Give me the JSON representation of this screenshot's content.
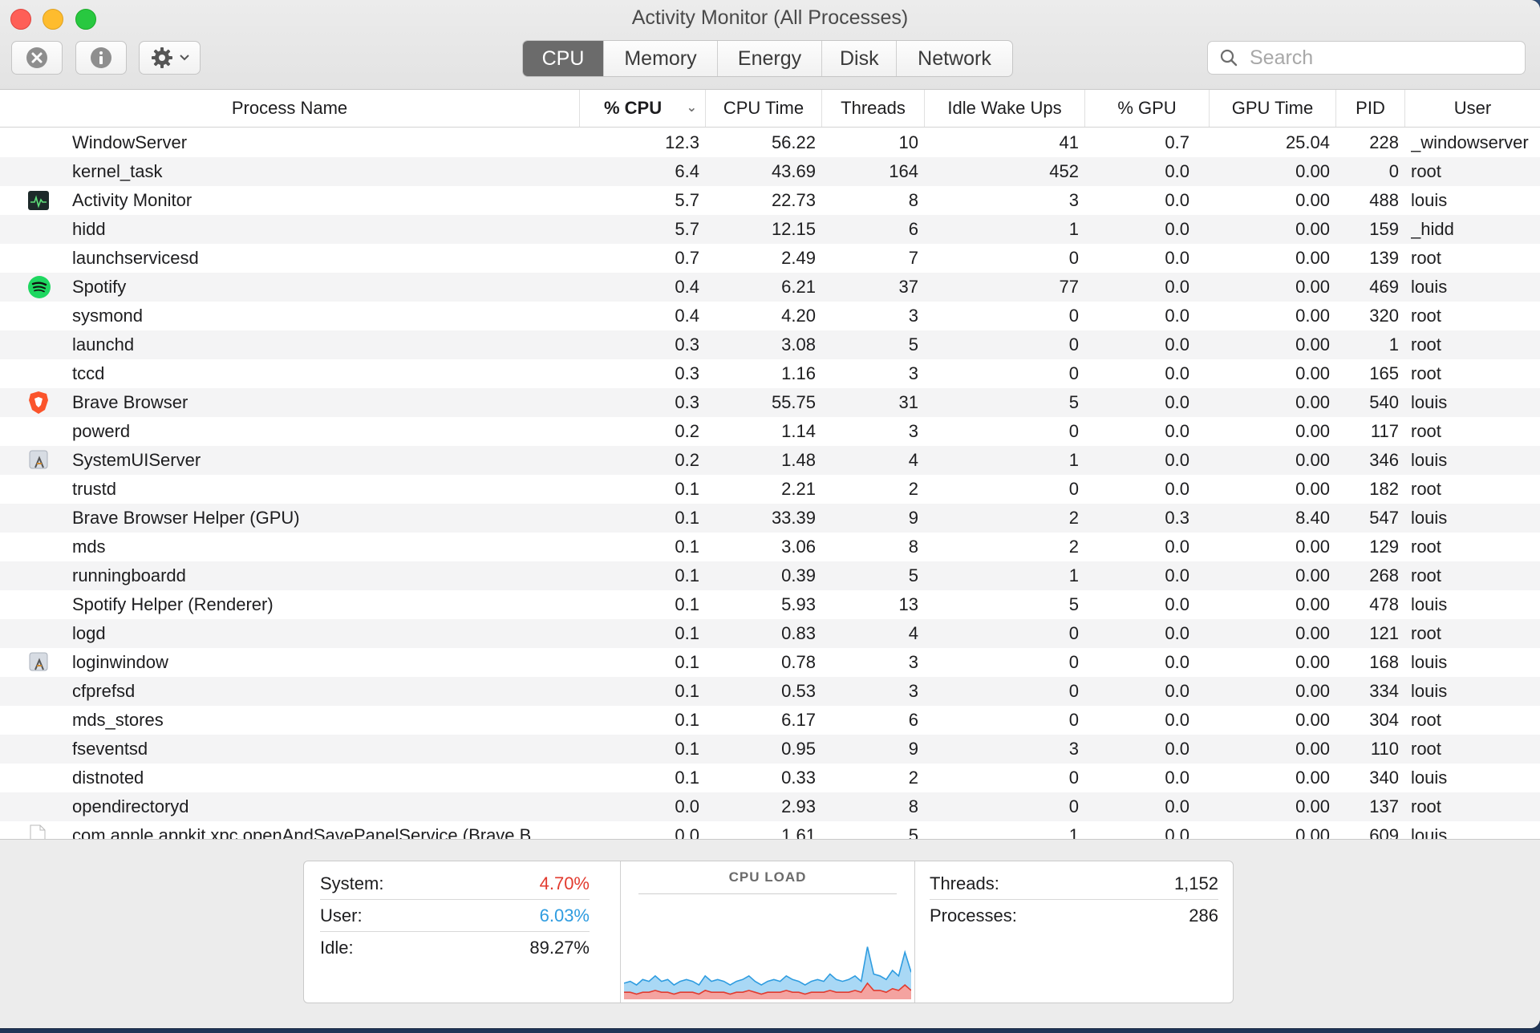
{
  "window": {
    "title": "Activity Monitor (All Processes)"
  },
  "toolbar": {
    "tabs": [
      {
        "label": "CPU",
        "active": true
      },
      {
        "label": "Memory",
        "active": false
      },
      {
        "label": "Energy",
        "active": false
      },
      {
        "label": "Disk",
        "active": false
      },
      {
        "label": "Network",
        "active": false
      }
    ],
    "search_placeholder": "Search",
    "icons": {
      "stop": "stop-process-icon",
      "info": "info-icon",
      "gear": "gear-icon"
    }
  },
  "table": {
    "columns": {
      "name": "Process Name",
      "cpu": "% CPU",
      "cpu_time": "CPU Time",
      "threads": "Threads",
      "idle_wake_ups": "Idle Wake Ups",
      "gpu": "% GPU",
      "gpu_time": "GPU Time",
      "pid": "PID",
      "user": "User"
    },
    "sorted_column": "cpu",
    "rows": [
      {
        "name": "WindowServer",
        "cpu": "12.3",
        "cpu_time": "56.22",
        "threads": "10",
        "idle": "41",
        "gpu": "0.7",
        "gpu_time": "25.04",
        "pid": "228",
        "user": "_windowserver",
        "icon": ""
      },
      {
        "name": "kernel_task",
        "cpu": "6.4",
        "cpu_time": "43.69",
        "threads": "164",
        "idle": "452",
        "gpu": "0.0",
        "gpu_time": "0.00",
        "pid": "0",
        "user": "root",
        "icon": ""
      },
      {
        "name": "Activity Monitor",
        "cpu": "5.7",
        "cpu_time": "22.73",
        "threads": "8",
        "idle": "3",
        "gpu": "0.0",
        "gpu_time": "0.00",
        "pid": "488",
        "user": "louis",
        "icon": "activity-monitor-icon"
      },
      {
        "name": "hidd",
        "cpu": "5.7",
        "cpu_time": "12.15",
        "threads": "6",
        "idle": "1",
        "gpu": "0.0",
        "gpu_time": "0.00",
        "pid": "159",
        "user": "_hidd",
        "icon": ""
      },
      {
        "name": "launchservicesd",
        "cpu": "0.7",
        "cpu_time": "2.49",
        "threads": "7",
        "idle": "0",
        "gpu": "0.0",
        "gpu_time": "0.00",
        "pid": "139",
        "user": "root",
        "icon": ""
      },
      {
        "name": "Spotify",
        "cpu": "0.4",
        "cpu_time": "6.21",
        "threads": "37",
        "idle": "77",
        "gpu": "0.0",
        "gpu_time": "0.00",
        "pid": "469",
        "user": "louis",
        "icon": "spotify-icon"
      },
      {
        "name": "sysmond",
        "cpu": "0.4",
        "cpu_time": "4.20",
        "threads": "3",
        "idle": "0",
        "gpu": "0.0",
        "gpu_time": "0.00",
        "pid": "320",
        "user": "root",
        "icon": ""
      },
      {
        "name": "launchd",
        "cpu": "0.3",
        "cpu_time": "3.08",
        "threads": "5",
        "idle": "0",
        "gpu": "0.0",
        "gpu_time": "0.00",
        "pid": "1",
        "user": "root",
        "icon": ""
      },
      {
        "name": "tccd",
        "cpu": "0.3",
        "cpu_time": "1.16",
        "threads": "3",
        "idle": "0",
        "gpu": "0.0",
        "gpu_time": "0.00",
        "pid": "165",
        "user": "root",
        "icon": ""
      },
      {
        "name": "Brave Browser",
        "cpu": "0.3",
        "cpu_time": "55.75",
        "threads": "31",
        "idle": "5",
        "gpu": "0.0",
        "gpu_time": "0.00",
        "pid": "540",
        "user": "louis",
        "icon": "brave-icon"
      },
      {
        "name": "powerd",
        "cpu": "0.2",
        "cpu_time": "1.14",
        "threads": "3",
        "idle": "0",
        "gpu": "0.0",
        "gpu_time": "0.00",
        "pid": "117",
        "user": "root",
        "icon": ""
      },
      {
        "name": "SystemUIServer",
        "cpu": "0.2",
        "cpu_time": "1.48",
        "threads": "4",
        "idle": "1",
        "gpu": "0.0",
        "gpu_time": "0.00",
        "pid": "346",
        "user": "louis",
        "icon": "app-generic-icon"
      },
      {
        "name": "trustd",
        "cpu": "0.1",
        "cpu_time": "2.21",
        "threads": "2",
        "idle": "0",
        "gpu": "0.0",
        "gpu_time": "0.00",
        "pid": "182",
        "user": "root",
        "icon": ""
      },
      {
        "name": "Brave Browser Helper (GPU)",
        "cpu": "0.1",
        "cpu_time": "33.39",
        "threads": "9",
        "idle": "2",
        "gpu": "0.3",
        "gpu_time": "8.40",
        "pid": "547",
        "user": "louis",
        "icon": ""
      },
      {
        "name": "mds",
        "cpu": "0.1",
        "cpu_time": "3.06",
        "threads": "8",
        "idle": "2",
        "gpu": "0.0",
        "gpu_time": "0.00",
        "pid": "129",
        "user": "root",
        "icon": ""
      },
      {
        "name": "runningboardd",
        "cpu": "0.1",
        "cpu_time": "0.39",
        "threads": "5",
        "idle": "1",
        "gpu": "0.0",
        "gpu_time": "0.00",
        "pid": "268",
        "user": "root",
        "icon": ""
      },
      {
        "name": "Spotify Helper (Renderer)",
        "cpu": "0.1",
        "cpu_time": "5.93",
        "threads": "13",
        "idle": "5",
        "gpu": "0.0",
        "gpu_time": "0.00",
        "pid": "478",
        "user": "louis",
        "icon": ""
      },
      {
        "name": "logd",
        "cpu": "0.1",
        "cpu_time": "0.83",
        "threads": "4",
        "idle": "0",
        "gpu": "0.0",
        "gpu_time": "0.00",
        "pid": "121",
        "user": "root",
        "icon": ""
      },
      {
        "name": "loginwindow",
        "cpu": "0.1",
        "cpu_time": "0.78",
        "threads": "3",
        "idle": "0",
        "gpu": "0.0",
        "gpu_time": "0.00",
        "pid": "168",
        "user": "louis",
        "icon": "app-generic-icon"
      },
      {
        "name": "cfprefsd",
        "cpu": "0.1",
        "cpu_time": "0.53",
        "threads": "3",
        "idle": "0",
        "gpu": "0.0",
        "gpu_time": "0.00",
        "pid": "334",
        "user": "louis",
        "icon": ""
      },
      {
        "name": "mds_stores",
        "cpu": "0.1",
        "cpu_time": "6.17",
        "threads": "6",
        "idle": "0",
        "gpu": "0.0",
        "gpu_time": "0.00",
        "pid": "304",
        "user": "root",
        "icon": ""
      },
      {
        "name": "fseventsd",
        "cpu": "0.1",
        "cpu_time": "0.95",
        "threads": "9",
        "idle": "3",
        "gpu": "0.0",
        "gpu_time": "0.00",
        "pid": "110",
        "user": "root",
        "icon": ""
      },
      {
        "name": "distnoted",
        "cpu": "0.1",
        "cpu_time": "0.33",
        "threads": "2",
        "idle": "0",
        "gpu": "0.0",
        "gpu_time": "0.00",
        "pid": "340",
        "user": "louis",
        "icon": ""
      },
      {
        "name": "opendirectoryd",
        "cpu": "0.0",
        "cpu_time": "2.93",
        "threads": "8",
        "idle": "0",
        "gpu": "0.0",
        "gpu_time": "0.00",
        "pid": "137",
        "user": "root",
        "icon": ""
      },
      {
        "name": "com.apple.appkit.xpc.openAndSavePanelService (Brave B...",
        "cpu": "0.0",
        "cpu_time": "1.61",
        "threads": "5",
        "idle": "1",
        "gpu": "0.0",
        "gpu_time": "0.00",
        "pid": "609",
        "user": "louis",
        "icon": "document-icon"
      }
    ]
  },
  "summary": {
    "system_label": "System:",
    "system_value": "4.70%",
    "user_label": "User:",
    "user_value": "6.03%",
    "idle_label": "Idle:",
    "idle_value": "89.27%",
    "cpu_load_title": "CPU LOAD",
    "threads_label": "Threads:",
    "threads_value": "1,152",
    "processes_label": "Processes:",
    "processes_value": "286",
    "colors": {
      "system": "#e23b2f",
      "user": "#2e9ce0"
    }
  },
  "cpu_load_history": {
    "user": [
      5,
      6,
      5,
      7,
      6,
      8,
      6,
      7,
      5,
      6,
      7,
      6,
      5,
      8,
      6,
      7,
      6,
      5,
      6,
      7,
      8,
      6,
      5,
      6,
      7,
      6,
      8,
      7,
      6,
      5,
      6,
      7,
      6,
      9,
      7,
      6,
      7,
      8,
      6,
      20,
      9,
      8,
      7,
      10,
      8,
      18,
      10
    ],
    "system": [
      3,
      3,
      2,
      3,
      3,
      4,
      3,
      3,
      2,
      3,
      3,
      3,
      2,
      4,
      3,
      3,
      3,
      2,
      3,
      3,
      4,
      3,
      2,
      3,
      3,
      3,
      4,
      3,
      3,
      2,
      3,
      3,
      3,
      4,
      3,
      3,
      3,
      4,
      3,
      8,
      4,
      4,
      3,
      5,
      4,
      7,
      4
    ]
  }
}
